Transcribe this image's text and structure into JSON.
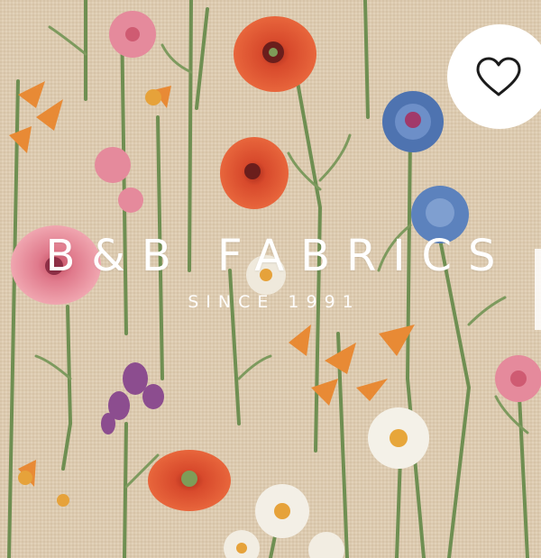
{
  "banner": {
    "brand_name": "B&B FABRICS",
    "tagline": "SINCE 1991",
    "background_icon": "floral-fabric-pattern-image",
    "colors": {
      "fabric_base": "#dccab0",
      "text": "#ffffff",
      "poppy": "#d5442a",
      "cornflower": "#4e73b0",
      "pink": "#e07a8c",
      "orange": "#e88a35",
      "stem": "#6f8f52"
    }
  },
  "favorite_button": {
    "icon": "heart-outline-icon",
    "color": "#1b1b1b"
  }
}
